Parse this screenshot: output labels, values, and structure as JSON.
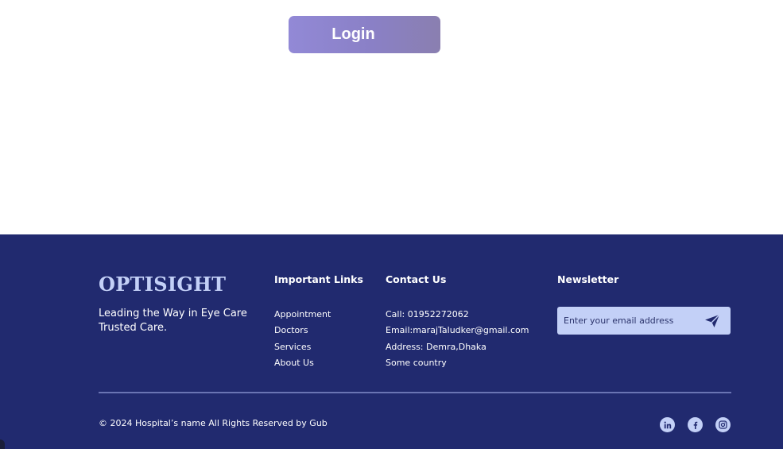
{
  "login": {
    "label": "Login"
  },
  "footer": {
    "brand": "OPTISIGHT",
    "tagline": "Leading the Way in Eye Care Trusted Care.",
    "links_title": "Important Links",
    "links": [
      "Appointment",
      "Doctors",
      "Services",
      "About Us"
    ],
    "contact_title": "Contact Us",
    "contact": [
      "Call: 01952272062",
      "Email:marajTaludker@gmail.com",
      "Address: Demra,Dhaka",
      "Some country"
    ],
    "newsletter_title": "Newsletter",
    "newsletter_placeholder": "Enter your email address",
    "copyright": "© 2024 Hospital’s name All Rights Reserved by Gub",
    "social_icons": [
      "linkedin-icon",
      "facebook-icon",
      "instagram-icon"
    ]
  },
  "colors": {
    "footer_bg": "#212a6f",
    "brand_text": "#c3d0f7",
    "input_bg": "#c3d0f7",
    "login_gradient_start": "#9289d6",
    "login_gradient_end": "#8a7fb0"
  }
}
